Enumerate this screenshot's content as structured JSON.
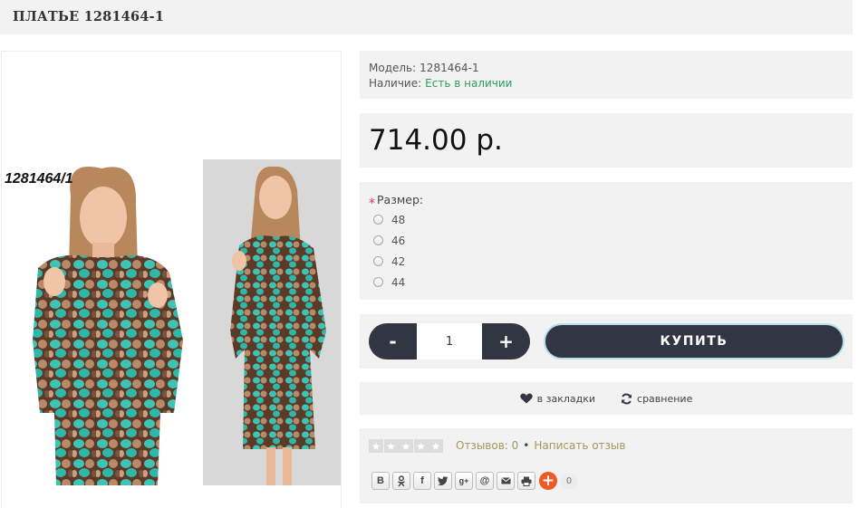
{
  "page": {
    "title": "ПЛАТЬЕ 1281464-1"
  },
  "image": {
    "code_label": "1281464/1"
  },
  "info": {
    "model_label": "Модель:",
    "model_value": "1281464-1",
    "stock_label": "Наличие:",
    "stock_value": "Есть в наличии"
  },
  "price": "714.00 р.",
  "options": {
    "required_mark": "*",
    "title": "Размер:",
    "sizes": [
      "48",
      "46",
      "42",
      "44"
    ]
  },
  "cart": {
    "minus_label": "-",
    "plus_label": "+",
    "quantity": "1",
    "buy_label": "КУПИТЬ"
  },
  "actions": {
    "wishlist_label": "в закладки",
    "compare_label": "сравнение"
  },
  "reviews": {
    "rating": 0,
    "rating_max": 5,
    "reviews_link": "Отзывов: 0",
    "separator": "•",
    "write_link": "Написать отзыв"
  },
  "share": {
    "buttons": [
      "В",
      "ok",
      "f",
      "t",
      "g+",
      "@",
      "mail",
      "print"
    ],
    "plus_label": "+",
    "count": "0"
  },
  "colors": {
    "panel_bg": "#f2f2f2",
    "dark_button": "#323643",
    "stock_green": "#2e9e5b",
    "link_gold": "#a7955d",
    "share_orange": "#f05a28",
    "required_red": "#e63946"
  }
}
